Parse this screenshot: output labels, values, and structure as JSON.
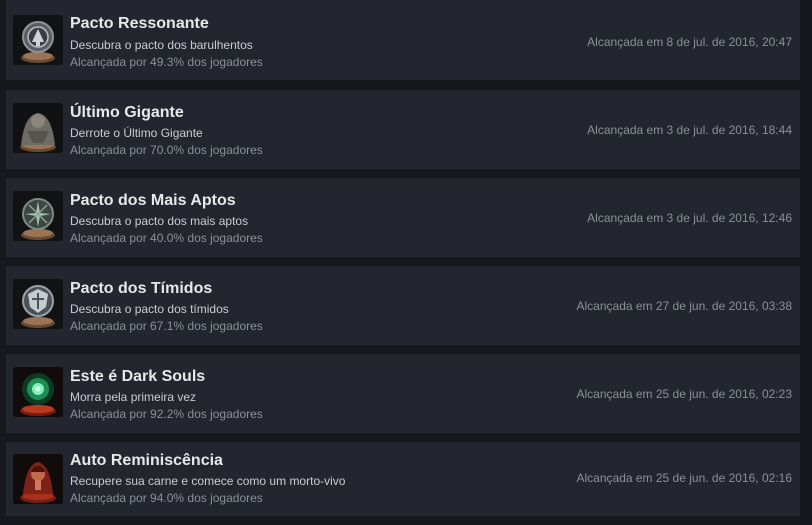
{
  "achievements": [
    {
      "title": "Pacto Ressonante",
      "description": "Descubra o pacto dos barulhentos",
      "percent": "Alcançada por 49.3% dos jogadores",
      "unlocked": "Alcançada em 8 de jul. de 2016, 20:47",
      "icon": "bell-emblem-icon"
    },
    {
      "title": "Último Gigante",
      "description": "Derrote o Último Gigante",
      "percent": "Alcançada por 70.0% dos jogadores",
      "unlocked": "Alcançada em 3 de jul. de 2016, 18:44",
      "icon": "giant-icon"
    },
    {
      "title": "Pacto dos Mais Aptos",
      "description": "Descubra o pacto dos mais aptos",
      "percent": "Alcançada por 40.0% dos jogadores",
      "unlocked": "Alcançada em 3 de jul. de 2016, 12:46",
      "icon": "thorn-emblem-icon"
    },
    {
      "title": "Pacto dos Tímidos",
      "description": "Descubra o pacto dos tímidos",
      "percent": "Alcançada por 67.1% dos jogadores",
      "unlocked": "Alcançada em 27 de jun. de 2016, 03:38",
      "icon": "shield-emblem-icon"
    },
    {
      "title": "Este é Dark Souls",
      "description": "Morra pela primeira vez",
      "percent": "Alcançada por 92.2% dos jogadores",
      "unlocked": "Alcançada em 25 de jun. de 2016, 02:23",
      "icon": "green-orb-icon"
    },
    {
      "title": "Auto Reminiscência",
      "description": "Recupere sua carne e comece como um morto-vivo",
      "percent": "Alcançada por 94.0% dos jogadores",
      "unlocked": "Alcançada em 25 de jun. de 2016, 02:16",
      "icon": "hooded-figure-icon"
    }
  ]
}
